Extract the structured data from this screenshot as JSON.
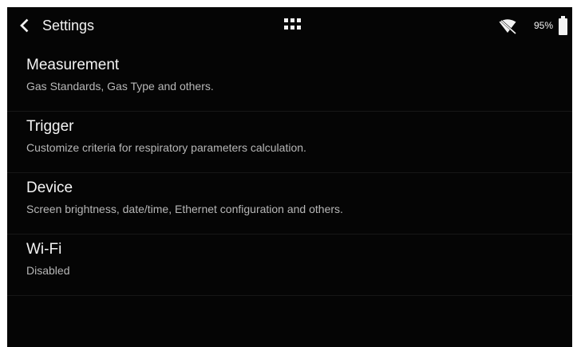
{
  "header": {
    "title": "Settings",
    "battery_percent": "95%"
  },
  "settings": {
    "items": [
      {
        "title": "Measurement",
        "subtitle": "Gas Standards, Gas Type and others."
      },
      {
        "title": "Trigger",
        "subtitle": "Customize criteria for respiratory parameters calculation."
      },
      {
        "title": "Device",
        "subtitle": "Screen brightness, date/time, Ethernet configuration and others."
      },
      {
        "title": "Wi-Fi",
        "subtitle": "Disabled"
      }
    ]
  },
  "icons": {
    "back": "chevron-left-icon",
    "apps": "grid-menu-icon",
    "wifi": "wifi-off-icon",
    "battery": "battery-icon"
  },
  "colors": {
    "background": "#050505",
    "text_primary": "#f4f4f4",
    "text_secondary": "#b7b7b7",
    "divider": "#171717"
  }
}
